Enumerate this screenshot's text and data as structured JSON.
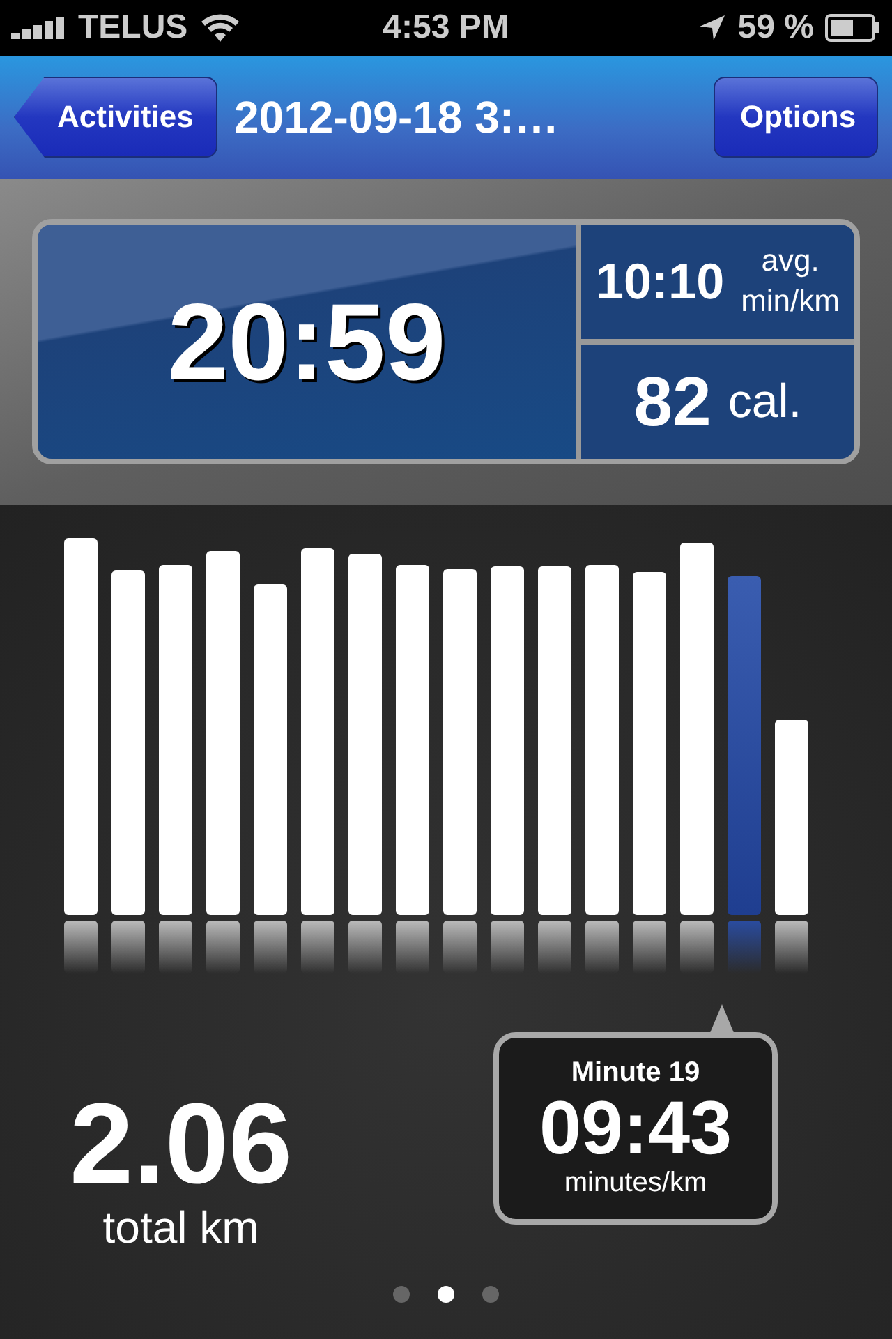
{
  "status_bar": {
    "carrier": "TELUS",
    "time": "4:53 PM",
    "battery_percent": "59 %"
  },
  "nav_bar": {
    "back_button": "Activities",
    "title": "2012-09-18 3:…",
    "right_button": "Options"
  },
  "summary": {
    "duration": "20:59",
    "pace": "10:10",
    "pace_unit_top": "avg.",
    "pace_unit_bottom": "min/km",
    "calories": "82",
    "calories_unit": "cal."
  },
  "bars": [
    {
      "selected": false
    },
    {
      "selected": false
    },
    {
      "selected": false
    },
    {
      "selected": false
    },
    {
      "selected": false
    },
    {
      "selected": false
    },
    {
      "selected": false
    },
    {
      "selected": false
    },
    {
      "selected": false
    },
    {
      "selected": false
    },
    {
      "selected": false
    },
    {
      "selected": false
    },
    {
      "selected": false
    },
    {
      "selected": false
    },
    {
      "selected": true
    },
    {
      "selected": false
    }
  ],
  "distance": {
    "value": "2.06",
    "label": "total km"
  },
  "callout": {
    "title": "Minute 19",
    "value": "09:43",
    "unit": "minutes/km"
  },
  "page_dots": [
    {
      "selected": false
    },
    {
      "selected": true
    },
    {
      "selected": false
    }
  ]
}
